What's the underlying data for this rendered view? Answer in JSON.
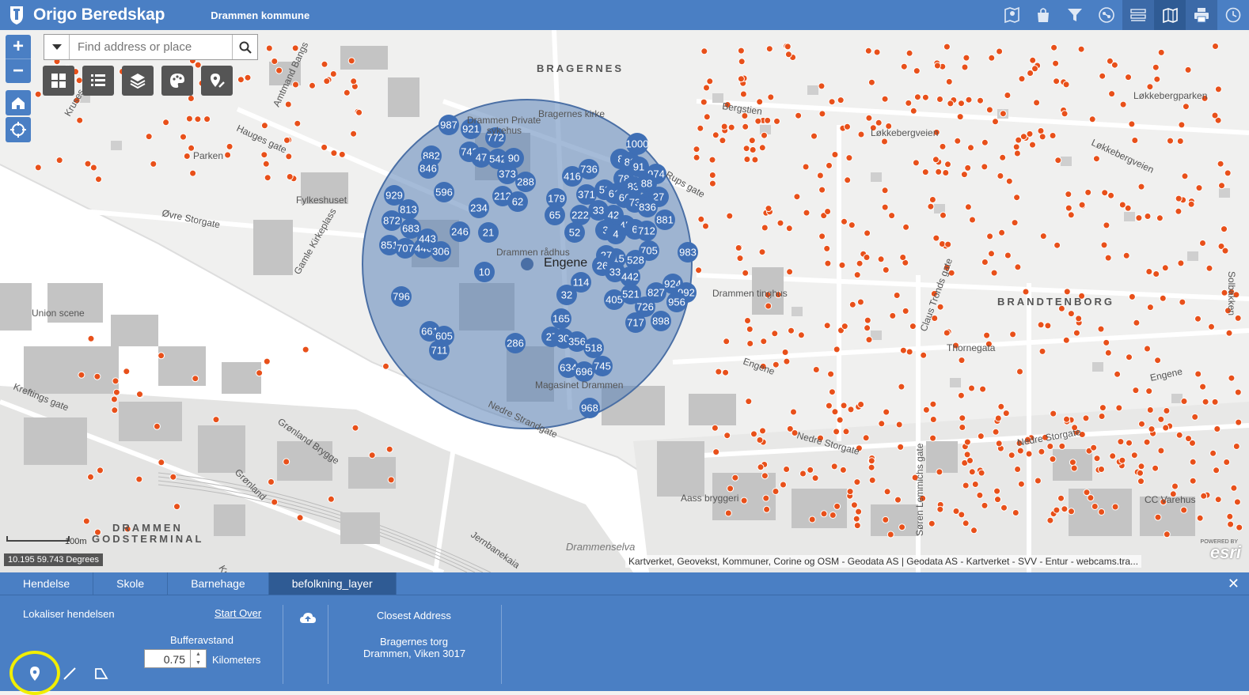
{
  "header": {
    "title": "Origo Beredskap",
    "subtitle": "Drammen kommune",
    "brand_color": "#4a7fc4",
    "tools": [
      {
        "icon": "map-pin-icon"
      },
      {
        "icon": "shopping-bag-icon"
      },
      {
        "icon": "filter-icon"
      },
      {
        "icon": "network-icon"
      },
      {
        "icon": "attribute-table-icon"
      },
      {
        "icon": "map-selection-icon"
      },
      {
        "icon": "printer-icon"
      },
      {
        "icon": "clock-icon"
      }
    ]
  },
  "search": {
    "placeholder": "Find address or place"
  },
  "map": {
    "labels": {
      "bragernes": "BRAGERNES",
      "brandtenborg": "BRANDTENBORG",
      "drammen": "DRAMMEN",
      "godsterminal": "GODSTERMINAL",
      "engene_center": "Engene",
      "bragernes_kirke": "Bragernes kirke",
      "drammen_private": "Drammen Private",
      "sykehus": "sykehus",
      "parken": "Parken",
      "fylkeshuset": "Fylkeshuset",
      "ovre_storgate": "Øvre Storgate",
      "union_scene": "Union scene",
      "drammen_radhus": "Drammen rådhus",
      "drammen_tinghus": "Drammen tinghus",
      "magasinet": "Magasinet Drammen",
      "aass_bryggeri": "Aass bryggeri",
      "cc_varehus": "CC Varehus",
      "drammenselva": "Drammenselva",
      "lokkebergparken": "Løkkebergparken",
      "lokkebergveien": "Løkkebergveien",
      "lokkebergveien2": "Løkkebergveien",
      "bergstien": "Bergstien",
      "hauges_gate": "Hauges gate",
      "krefting_gate": "Kreftings gate",
      "gronland_brygge": "Grønland Brygge",
      "gronland": "Grønland",
      "jernbanekaia": "Jernbanekaia",
      "nedre_strandgate": "Nedre Strandgate",
      "nedre_storgate": "Nedre Storgate",
      "nedre_storgate2": "Nedre Storgate",
      "thornegata": "Thornegata",
      "engene_street": "Engene",
      "engene_street2": "Engene",
      "claus_tronds_gate": "Claus Tronds gate",
      "soren_lemmichs_gate": "Søren Lemmichs gate",
      "gamle_kirkeplass": "Gamle Kirkeplass",
      "amtmand_bang": "Amtmand Bangs",
      "kreftings_gate2": "Kreftings gate",
      "rups_gate": "Rups gate",
      "solbakken": "Solbakken",
      "kruses": "Kruses"
    },
    "clusters": [
      "987",
      "921",
      "772",
      "882",
      "743",
      "47",
      "542",
      "90",
      "846",
      "373",
      "288",
      "929",
      "596",
      "212",
      "62",
      "813",
      "234",
      "872",
      "683",
      "246",
      "21",
      "851",
      "707",
      "446",
      "443",
      "306",
      "10",
      "796",
      "661",
      "605",
      "711",
      "286",
      "27",
      "30",
      "356",
      "165",
      "518",
      "634",
      "696",
      "745",
      "968",
      "416",
      "179",
      "371",
      "65",
      "222",
      "52",
      "33",
      "736",
      "8",
      "89",
      "91",
      "974",
      "78",
      "83",
      "88",
      "52",
      "61",
      "66",
      "73",
      "93",
      "27",
      "42",
      "836",
      "881",
      "45",
      "6",
      "712",
      "3",
      "4",
      "705",
      "528",
      "315",
      "27",
      "26",
      "33",
      "442",
      "983",
      "114",
      "32",
      "924",
      "992",
      "405",
      "521",
      "827",
      "956",
      "726",
      "898",
      "717",
      "1000"
    ],
    "scale_label": "100m",
    "coordinates": "10.195 59.743 Degrees",
    "attribution": "Kartverket, Geovekst, Kommuner, Corine og OSM - Geodata AS | Geodata AS - Kartverket - SVV - Entur - webcams.tra...",
    "esri_logo": "esri",
    "powered_by": "POWERED BY",
    "buffer_color": "#5b83b8"
  },
  "panel": {
    "tabs": [
      "Hendelse",
      "Skole",
      "Barnehage",
      "befolkning_layer"
    ],
    "active_tab": "befolkning_layer",
    "locate_label": "Lokaliser hendelsen",
    "start_over": "Start Over",
    "buffer_label": "Bufferavstand",
    "buffer_value": "0.75",
    "buffer_unit": "Kilometers",
    "closest_address_label": "Closest Address",
    "address_line1": "Bragernes torg",
    "address_line2": "Drammen, Viken 3017"
  }
}
